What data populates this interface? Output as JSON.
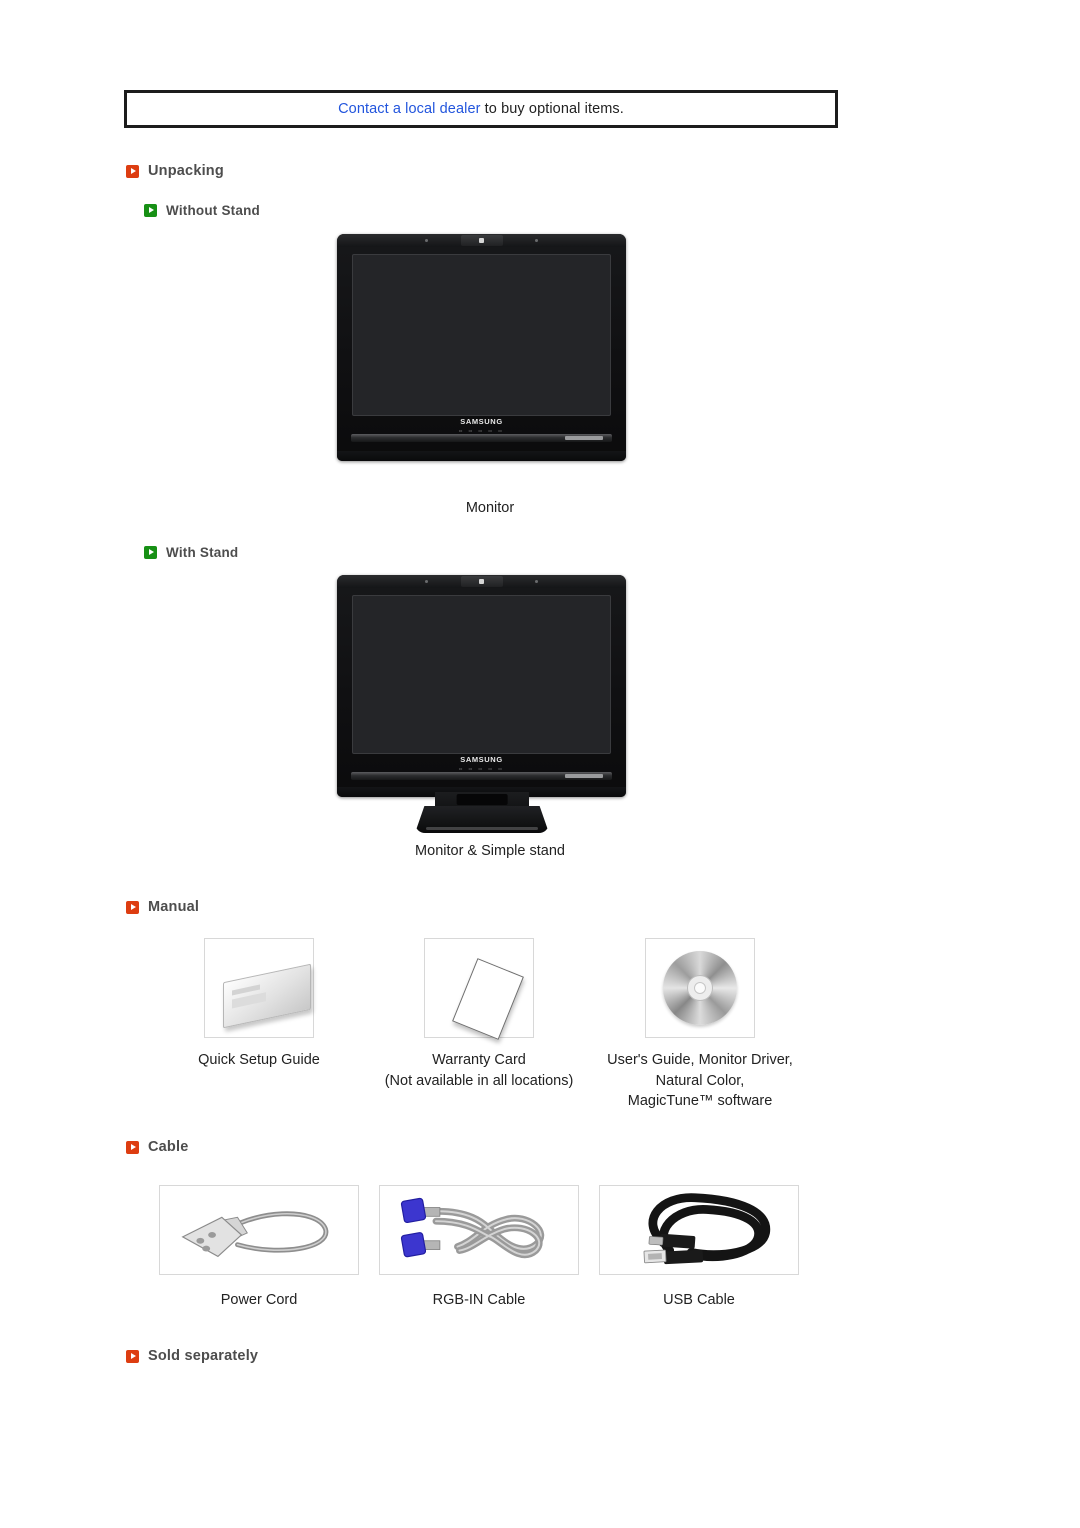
{
  "notice": {
    "link_text": "Contact a local dealer",
    "rest_text": " to buy optional items."
  },
  "sections": {
    "unpacking": {
      "title": "Unpacking",
      "bullet_color": "#dd3d11",
      "subsections": [
        {
          "title": "Without Stand",
          "bullet_color": "#179015",
          "caption": "Monitor",
          "product_brand": "SAMSUNG"
        },
        {
          "title": "With Stand",
          "bullet_color": "#179015",
          "caption": "Monitor & Simple stand",
          "product_brand": "SAMSUNG"
        }
      ]
    },
    "manual": {
      "title": "Manual",
      "bullet_color": "#dd3d11",
      "items": [
        {
          "icon": "booklet-icon",
          "caption_line1": "Quick Setup Guide",
          "caption_line2": "",
          "caption_line3": ""
        },
        {
          "icon": "warranty-card-icon",
          "caption_line1": "Warranty Card",
          "caption_line2": "(Not available in all locations)",
          "caption_line3": ""
        },
        {
          "icon": "cd-disc-icon",
          "caption_line1": "User's Guide, Monitor Driver,",
          "caption_line2": "Natural Color,",
          "caption_line3": "MagicTune™ software"
        }
      ]
    },
    "cable": {
      "title": "Cable",
      "bullet_color": "#dd3d11",
      "items": [
        {
          "icon": "power-cord-icon",
          "caption": "Power Cord"
        },
        {
          "icon": "rgb-in-cable-icon",
          "caption": "RGB-IN Cable"
        },
        {
          "icon": "usb-cable-icon",
          "caption": "USB Cable"
        }
      ]
    },
    "sold_separately": {
      "title": "Sold separately",
      "bullet_color": "#dd3d11"
    }
  }
}
